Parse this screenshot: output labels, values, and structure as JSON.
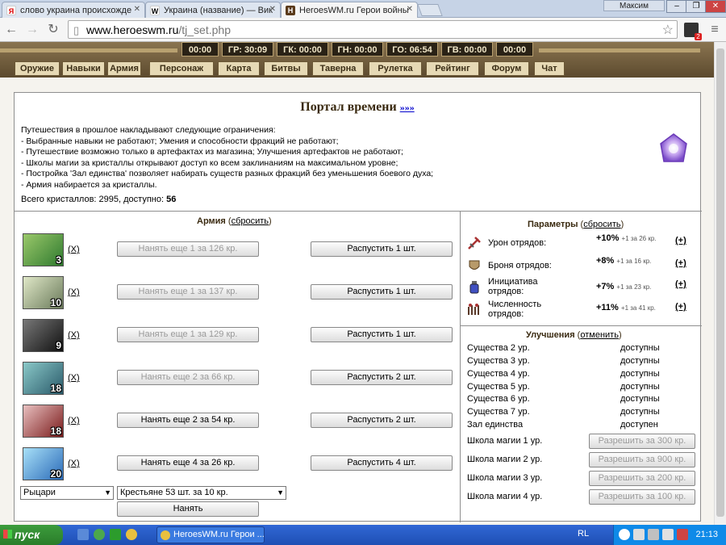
{
  "browser": {
    "tabs": [
      {
        "title": "слово украина происхожде",
        "favicon": "Я"
      },
      {
        "title": "Украина (название) — Вик",
        "favicon": "W"
      },
      {
        "title": "HeroesWM.ru Герои войны",
        "favicon": "H"
      }
    ],
    "profile": "Максим",
    "url_host": "www.heroeswm.ru",
    "url_path": "/tj_set.php",
    "ext_badge": "2"
  },
  "game_header": {
    "timers": [
      "00:00",
      "ГР: 30:09",
      "ГК: 00:00",
      "ГН: 00:00",
      "ГО: 06:54",
      "ГВ: 00:00",
      "00:00"
    ],
    "nav": [
      "Оружие",
      "Навыки",
      "Армия",
      "Персонаж",
      "Карта",
      "Битвы",
      "Таверна",
      "Рулетка",
      "Рейтинг",
      "Форум",
      "Чат"
    ]
  },
  "portal": {
    "title": "Портал времени",
    "title_link": "»»»",
    "intro": [
      "Путешествия в прошлое накладывают следующие ограничения:",
      "- Выбранные навыки не работают; Умения и способности фракций не работают;",
      "- Путешествие возможно только в артефактах из магазина; Улучшения артефактов не работают;",
      "- Школы магии за кристаллы открывают доступ ко всем заклинаниям на максимальном уровне;",
      "- Постройка 'Зал единства' позволяет набирать существ разных фракций без уменьшения боевого духа;",
      "- Армия набирается за кристаллы."
    ],
    "totals_label": "Всего кристаллов: 2995, доступно: ",
    "totals_available": "56"
  },
  "army": {
    "heading": "Армия",
    "reset": "сбросить",
    "units": [
      {
        "count": "3",
        "x": "(X)",
        "hire": "Нанять еще 1 за 126 кр.",
        "hire_enabled": false,
        "dismiss": "Распустить 1 шт.",
        "color": "#2f7a2f"
      },
      {
        "count": "10",
        "x": "(X)",
        "hire": "Нанять еще 1 за 137 кр.",
        "hire_enabled": false,
        "dismiss": "Распустить 1 шт.",
        "color": "#8a9a7a"
      },
      {
        "count": "9",
        "x": "(X)",
        "hire": "Нанять еще 1 за 129 кр.",
        "hire_enabled": false,
        "dismiss": "Распустить 1 шт.",
        "color": "#2a2a2a"
      },
      {
        "count": "18",
        "x": "(X)",
        "hire": "Нанять еще 2 за 66 кр.",
        "hire_enabled": false,
        "dismiss": "Распустить 2 шт.",
        "color": "#3f7f8a"
      },
      {
        "count": "18",
        "x": "(X)",
        "hire": "Нанять еще 2 за 54 кр.",
        "hire_enabled": true,
        "dismiss": "Распустить 2 шт.",
        "color": "#a03030"
      },
      {
        "count": "20",
        "x": "(X)",
        "hire": "Нанять еще 4 за 26 кр.",
        "hire_enabled": true,
        "dismiss": "Распустить 4 шт.",
        "color": "#3a8ac8"
      }
    ],
    "faction_select": "Рыцари",
    "unit_select": "Крестьяне 53 шт. за 10 кр.",
    "hire_button": "Нанять"
  },
  "params": {
    "heading": "Параметры",
    "reset": "сбросить",
    "rows": [
      {
        "label": "Урон отрядов:",
        "value": "+10%",
        "cost": "+1 за 26 кр.",
        "plus": "(+)"
      },
      {
        "label": "Броня отрядов:",
        "value": "+8%",
        "cost": "+1 за 16 кр.",
        "plus": "(+)"
      },
      {
        "label": "Инициатива отрядов:",
        "value": "+7%",
        "cost": "+1 за 23 кр.",
        "plus": "(+)"
      },
      {
        "label": "Численность отрядов:",
        "value": "+11%",
        "cost": "+1 за 41 кр.",
        "plus": "(+)"
      }
    ]
  },
  "upgrades": {
    "heading": "Улучшения",
    "cancel": "отменить",
    "rows": [
      {
        "name": "Существа 2 ур.",
        "status": "доступны"
      },
      {
        "name": "Существа 3 ур.",
        "status": "доступны"
      },
      {
        "name": "Существа 4 ур.",
        "status": "доступны"
      },
      {
        "name": "Существа 5 ур.",
        "status": "доступны"
      },
      {
        "name": "Существа 6 ур.",
        "status": "доступны"
      },
      {
        "name": "Существа 7 ур.",
        "status": "доступны"
      },
      {
        "name": "Зал единства",
        "status": "доступен"
      }
    ],
    "magic": [
      {
        "name": "Школа магии 1 ур.",
        "button": "Разрешить за 300 кр."
      },
      {
        "name": "Школа магии 2 ур.",
        "button": "Разрешить за 900 кр."
      },
      {
        "name": "Школа магии 3 ур.",
        "button": "Разрешить за 200 кр."
      },
      {
        "name": "Школа магии 4 ур.",
        "button": "Разрешить за 100 кр."
      }
    ]
  },
  "taskbar": {
    "start": "пуск",
    "task": "HeroesWM.ru Герои ...",
    "lang": "RL",
    "clock": "21:13"
  }
}
